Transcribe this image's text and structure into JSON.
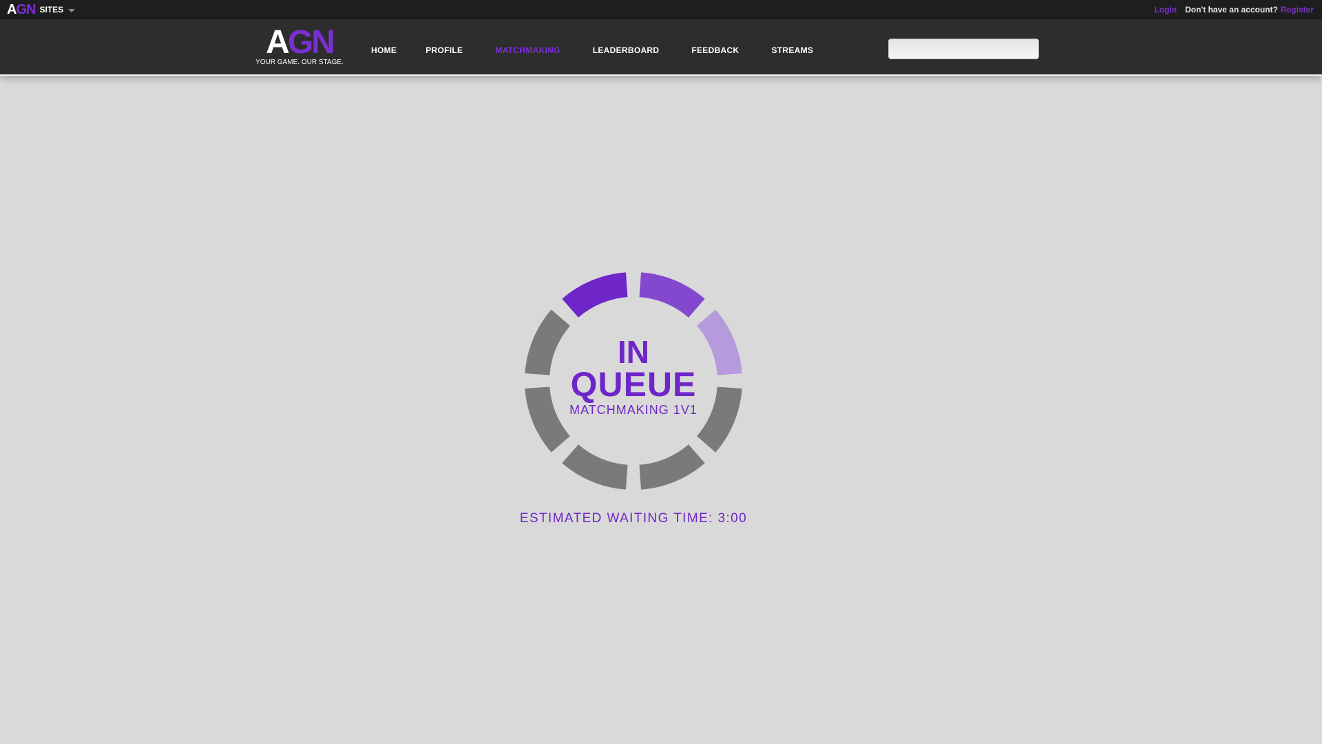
{
  "topbar": {
    "brand_a": "A",
    "brand_gn": "GN",
    "sites_label": "SITES",
    "login": "Login",
    "no_account": "Don't have an account?",
    "register": "Register"
  },
  "header": {
    "logo_a": "A",
    "logo_gn": "GN",
    "tagline": "YOUR GAME. OUR STAGE.",
    "nav": [
      {
        "label": "HOME",
        "active": false
      },
      {
        "label": "PROFILE",
        "active": false
      },
      {
        "label": "MATCHMAKING",
        "active": true
      },
      {
        "label": "LEADERBOARD",
        "active": false
      },
      {
        "label": "FEEDBACK",
        "active": false
      },
      {
        "label": "STREAMS",
        "active": false
      }
    ],
    "search_value": ""
  },
  "queue": {
    "status_line1": "IN",
    "status_line2": "QUEUE",
    "mode": "MATCHMAKING 1V1",
    "estimated_wait": "ESTIMATED WAITING TIME: 3:00"
  },
  "colors": {
    "accent": "#6f26c8",
    "spinner_dark": "#7a7a7a",
    "spinner_segments": [
      "#6f26c8",
      "#8448cf",
      "#b79adb",
      "#7a7a7a",
      "#7a7a7a",
      "#7a7a7a",
      "#7a7a7a",
      "#7a7a7a"
    ],
    "page_bg": "#d9d9d9",
    "header_bg": "#2d2d2d",
    "topbar_bg": "#1e1e1e"
  }
}
